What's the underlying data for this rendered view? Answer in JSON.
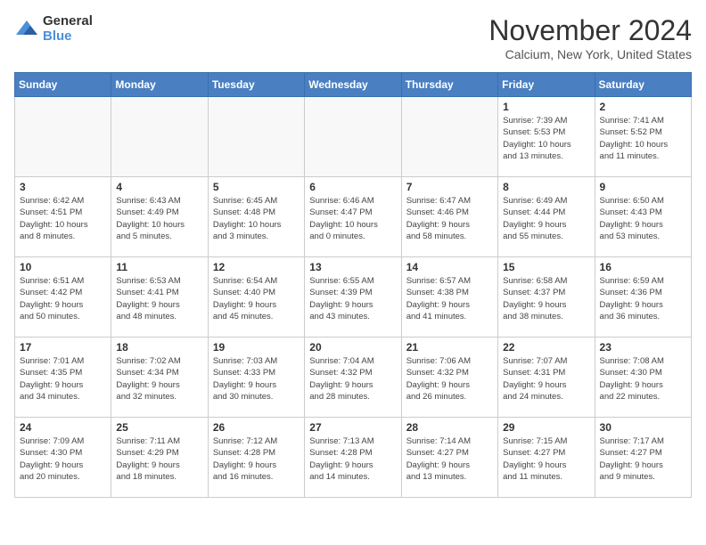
{
  "header": {
    "logo_general": "General",
    "logo_blue": "Blue",
    "month_title": "November 2024",
    "subtitle": "Calcium, New York, United States"
  },
  "weekdays": [
    "Sunday",
    "Monday",
    "Tuesday",
    "Wednesday",
    "Thursday",
    "Friday",
    "Saturday"
  ],
  "weeks": [
    [
      {
        "day": "",
        "info": ""
      },
      {
        "day": "",
        "info": ""
      },
      {
        "day": "",
        "info": ""
      },
      {
        "day": "",
        "info": ""
      },
      {
        "day": "",
        "info": ""
      },
      {
        "day": "1",
        "info": "Sunrise: 7:39 AM\nSunset: 5:53 PM\nDaylight: 10 hours\nand 13 minutes."
      },
      {
        "day": "2",
        "info": "Sunrise: 7:41 AM\nSunset: 5:52 PM\nDaylight: 10 hours\nand 11 minutes."
      }
    ],
    [
      {
        "day": "3",
        "info": "Sunrise: 6:42 AM\nSunset: 4:51 PM\nDaylight: 10 hours\nand 8 minutes."
      },
      {
        "day": "4",
        "info": "Sunrise: 6:43 AM\nSunset: 4:49 PM\nDaylight: 10 hours\nand 5 minutes."
      },
      {
        "day": "5",
        "info": "Sunrise: 6:45 AM\nSunset: 4:48 PM\nDaylight: 10 hours\nand 3 minutes."
      },
      {
        "day": "6",
        "info": "Sunrise: 6:46 AM\nSunset: 4:47 PM\nDaylight: 10 hours\nand 0 minutes."
      },
      {
        "day": "7",
        "info": "Sunrise: 6:47 AM\nSunset: 4:46 PM\nDaylight: 9 hours\nand 58 minutes."
      },
      {
        "day": "8",
        "info": "Sunrise: 6:49 AM\nSunset: 4:44 PM\nDaylight: 9 hours\nand 55 minutes."
      },
      {
        "day": "9",
        "info": "Sunrise: 6:50 AM\nSunset: 4:43 PM\nDaylight: 9 hours\nand 53 minutes."
      }
    ],
    [
      {
        "day": "10",
        "info": "Sunrise: 6:51 AM\nSunset: 4:42 PM\nDaylight: 9 hours\nand 50 minutes."
      },
      {
        "day": "11",
        "info": "Sunrise: 6:53 AM\nSunset: 4:41 PM\nDaylight: 9 hours\nand 48 minutes."
      },
      {
        "day": "12",
        "info": "Sunrise: 6:54 AM\nSunset: 4:40 PM\nDaylight: 9 hours\nand 45 minutes."
      },
      {
        "day": "13",
        "info": "Sunrise: 6:55 AM\nSunset: 4:39 PM\nDaylight: 9 hours\nand 43 minutes."
      },
      {
        "day": "14",
        "info": "Sunrise: 6:57 AM\nSunset: 4:38 PM\nDaylight: 9 hours\nand 41 minutes."
      },
      {
        "day": "15",
        "info": "Sunrise: 6:58 AM\nSunset: 4:37 PM\nDaylight: 9 hours\nand 38 minutes."
      },
      {
        "day": "16",
        "info": "Sunrise: 6:59 AM\nSunset: 4:36 PM\nDaylight: 9 hours\nand 36 minutes."
      }
    ],
    [
      {
        "day": "17",
        "info": "Sunrise: 7:01 AM\nSunset: 4:35 PM\nDaylight: 9 hours\nand 34 minutes."
      },
      {
        "day": "18",
        "info": "Sunrise: 7:02 AM\nSunset: 4:34 PM\nDaylight: 9 hours\nand 32 minutes."
      },
      {
        "day": "19",
        "info": "Sunrise: 7:03 AM\nSunset: 4:33 PM\nDaylight: 9 hours\nand 30 minutes."
      },
      {
        "day": "20",
        "info": "Sunrise: 7:04 AM\nSunset: 4:32 PM\nDaylight: 9 hours\nand 28 minutes."
      },
      {
        "day": "21",
        "info": "Sunrise: 7:06 AM\nSunset: 4:32 PM\nDaylight: 9 hours\nand 26 minutes."
      },
      {
        "day": "22",
        "info": "Sunrise: 7:07 AM\nSunset: 4:31 PM\nDaylight: 9 hours\nand 24 minutes."
      },
      {
        "day": "23",
        "info": "Sunrise: 7:08 AM\nSunset: 4:30 PM\nDaylight: 9 hours\nand 22 minutes."
      }
    ],
    [
      {
        "day": "24",
        "info": "Sunrise: 7:09 AM\nSunset: 4:30 PM\nDaylight: 9 hours\nand 20 minutes."
      },
      {
        "day": "25",
        "info": "Sunrise: 7:11 AM\nSunset: 4:29 PM\nDaylight: 9 hours\nand 18 minutes."
      },
      {
        "day": "26",
        "info": "Sunrise: 7:12 AM\nSunset: 4:28 PM\nDaylight: 9 hours\nand 16 minutes."
      },
      {
        "day": "27",
        "info": "Sunrise: 7:13 AM\nSunset: 4:28 PM\nDaylight: 9 hours\nand 14 minutes."
      },
      {
        "day": "28",
        "info": "Sunrise: 7:14 AM\nSunset: 4:27 PM\nDaylight: 9 hours\nand 13 minutes."
      },
      {
        "day": "29",
        "info": "Sunrise: 7:15 AM\nSunset: 4:27 PM\nDaylight: 9 hours\nand 11 minutes."
      },
      {
        "day": "30",
        "info": "Sunrise: 7:17 AM\nSunset: 4:27 PM\nDaylight: 9 hours\nand 9 minutes."
      }
    ]
  ]
}
